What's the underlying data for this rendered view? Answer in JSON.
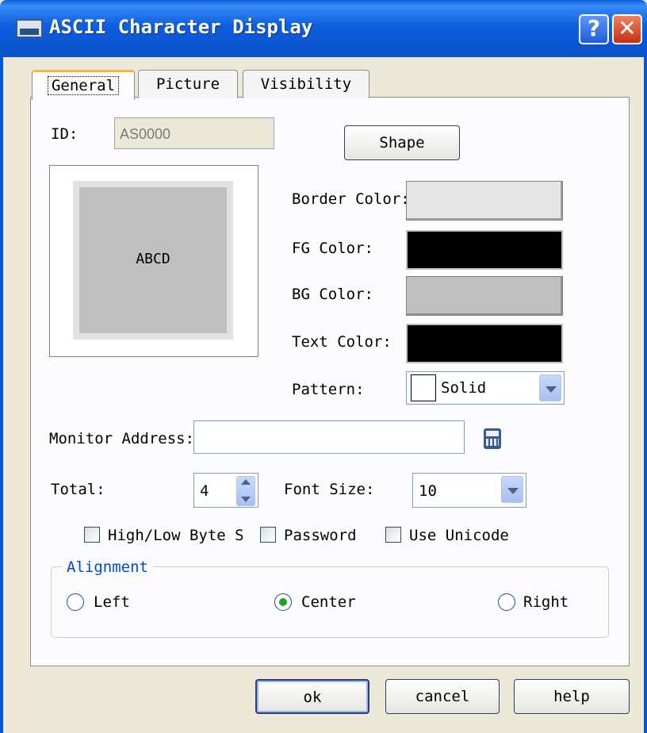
{
  "window": {
    "title": "ASCII Character Display",
    "help_glyph": "?",
    "close_glyph": "✕"
  },
  "tabs": [
    {
      "label": "General",
      "active": true
    },
    {
      "label": "Picture"
    },
    {
      "label": "Visibility"
    }
  ],
  "general": {
    "id_label": "ID:",
    "id_value": "AS0000",
    "shape_button": "Shape",
    "preview_text": "ABCD",
    "border_color_label": "Border Color:",
    "fg_color_label": "FG Color:",
    "bg_color_label": "BG Color:",
    "text_color_label": "Text Color:",
    "colors": {
      "border": "#e6e6e6",
      "fg": "#000000",
      "bg": "#c0c0c0",
      "text": "#000000"
    },
    "pattern_label": "Pattern:",
    "pattern_value": "Solid",
    "monitor_address_label": "Monitor Address:",
    "monitor_address_value": "",
    "total_label": "Total:",
    "total_value": "4",
    "font_size_label": "Font Size:",
    "font_size_value": "10",
    "checkboxes": {
      "high_low_byte": {
        "label": "High/Low Byte S",
        "checked": false
      },
      "password": {
        "label": "Password",
        "checked": false
      },
      "use_unicode": {
        "label": "Use Unicode",
        "checked": false
      }
    },
    "alignment": {
      "legend": "Alignment",
      "left": "Left",
      "center": "Center",
      "right": "Right",
      "selected": "Center"
    }
  },
  "footer": {
    "ok": "ok",
    "cancel": "cancel",
    "help": "help"
  }
}
